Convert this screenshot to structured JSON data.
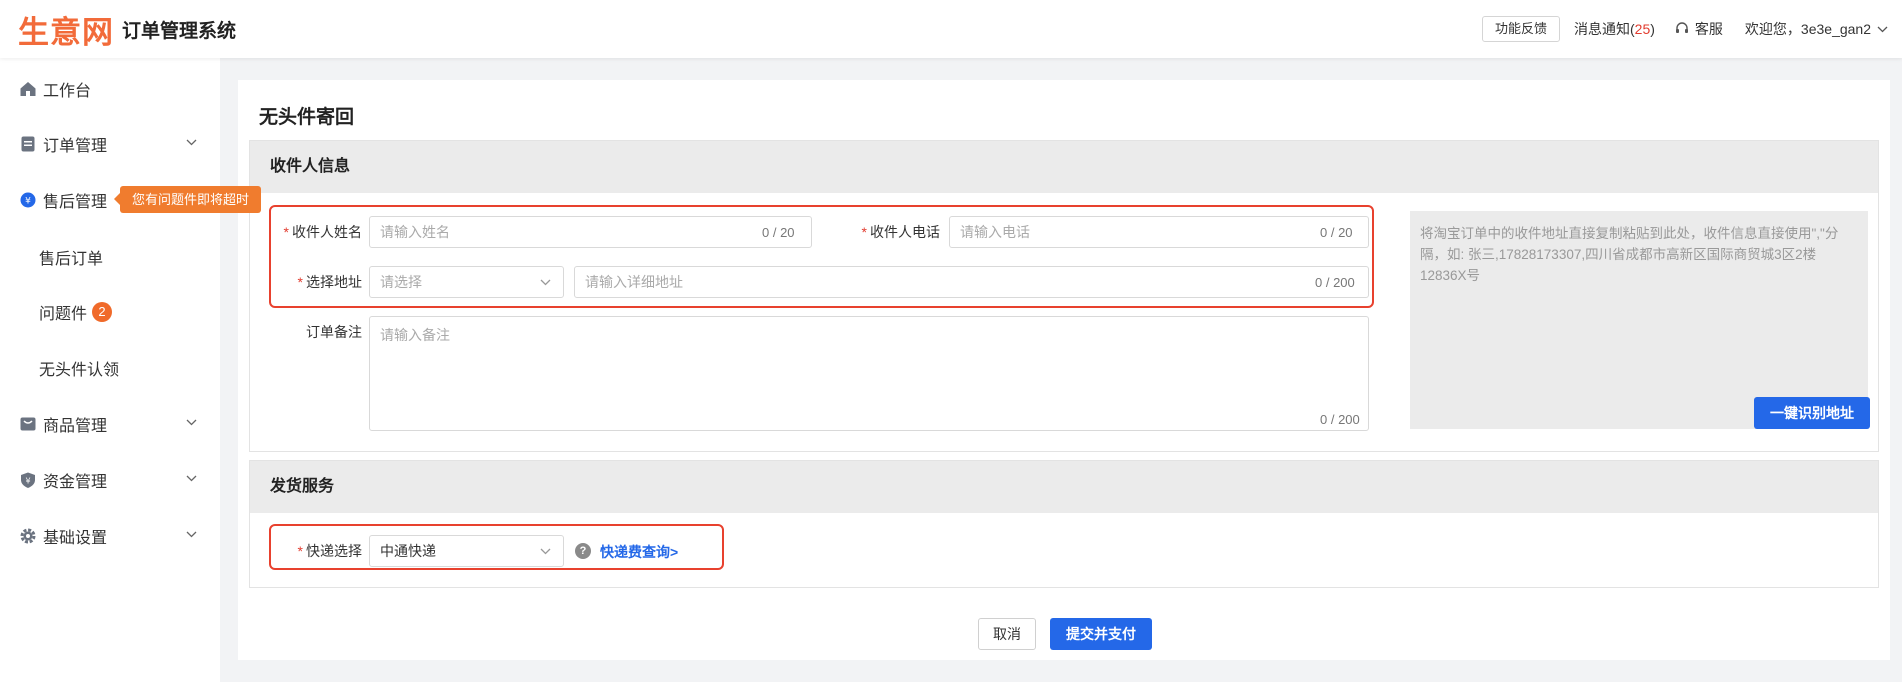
{
  "header": {
    "logo_text": "生意网",
    "system_name": "订单管理系统",
    "feedback_label": "功能反馈",
    "notice_label": "消息通知(",
    "notice_count": "25",
    "notice_close": ")",
    "service_label": "客服",
    "welcome_label": "欢迎您，3e3e_gan2"
  },
  "sidebar": {
    "items": [
      {
        "label": "工作台",
        "icon": "home-icon"
      },
      {
        "label": "订单管理",
        "icon": "order-icon"
      },
      {
        "label": "售后管理",
        "icon": "aftersale-icon"
      },
      {
        "label": "商品管理",
        "icon": "goods-icon"
      },
      {
        "label": "资金管理",
        "icon": "shield-icon"
      },
      {
        "label": "基础设置",
        "icon": "gear-icon"
      }
    ],
    "sub_items": [
      {
        "label": "售后订单"
      },
      {
        "label": "问题件",
        "badge": "2"
      },
      {
        "label": "无头件认领"
      }
    ],
    "tooltip": "您有问题件即将超时"
  },
  "page": {
    "title": "无头件寄回",
    "receiver_section": {
      "title": "收件人信息",
      "name_label": "收件人姓名",
      "name_placeholder": "请输入姓名",
      "name_count": "0 / 20",
      "phone_label": "收件人电话",
      "phone_placeholder": "请输入电话",
      "phone_count": "0 / 20",
      "address_label": "选择地址",
      "region_placeholder": "请选择",
      "detail_placeholder": "请输入详细地址",
      "detail_count": "0 / 200",
      "remark_label": "订单备注",
      "remark_placeholder": "请输入备注",
      "remark_count": "0 / 200",
      "paste_hint": "将淘宝订单中的收件地址直接复制粘贴到此处，收件信息直接使用\",\"分隔，如: 张三,17828173307,四川省成都市高新区国际商贸城3区2楼12836X号",
      "recognize_button": "一键识别地址"
    },
    "shipping_section": {
      "title": "发货服务",
      "express_label": "快递选择",
      "express_value": "中通快递",
      "fee_link": "快递费查询>"
    },
    "cancel_button": "取消",
    "submit_button": "提交并支付"
  },
  "colors": {
    "brand": "#f26b3a",
    "primary": "#2468e8",
    "required": "#e23b2e",
    "highlight_box": "#e8412e"
  }
}
